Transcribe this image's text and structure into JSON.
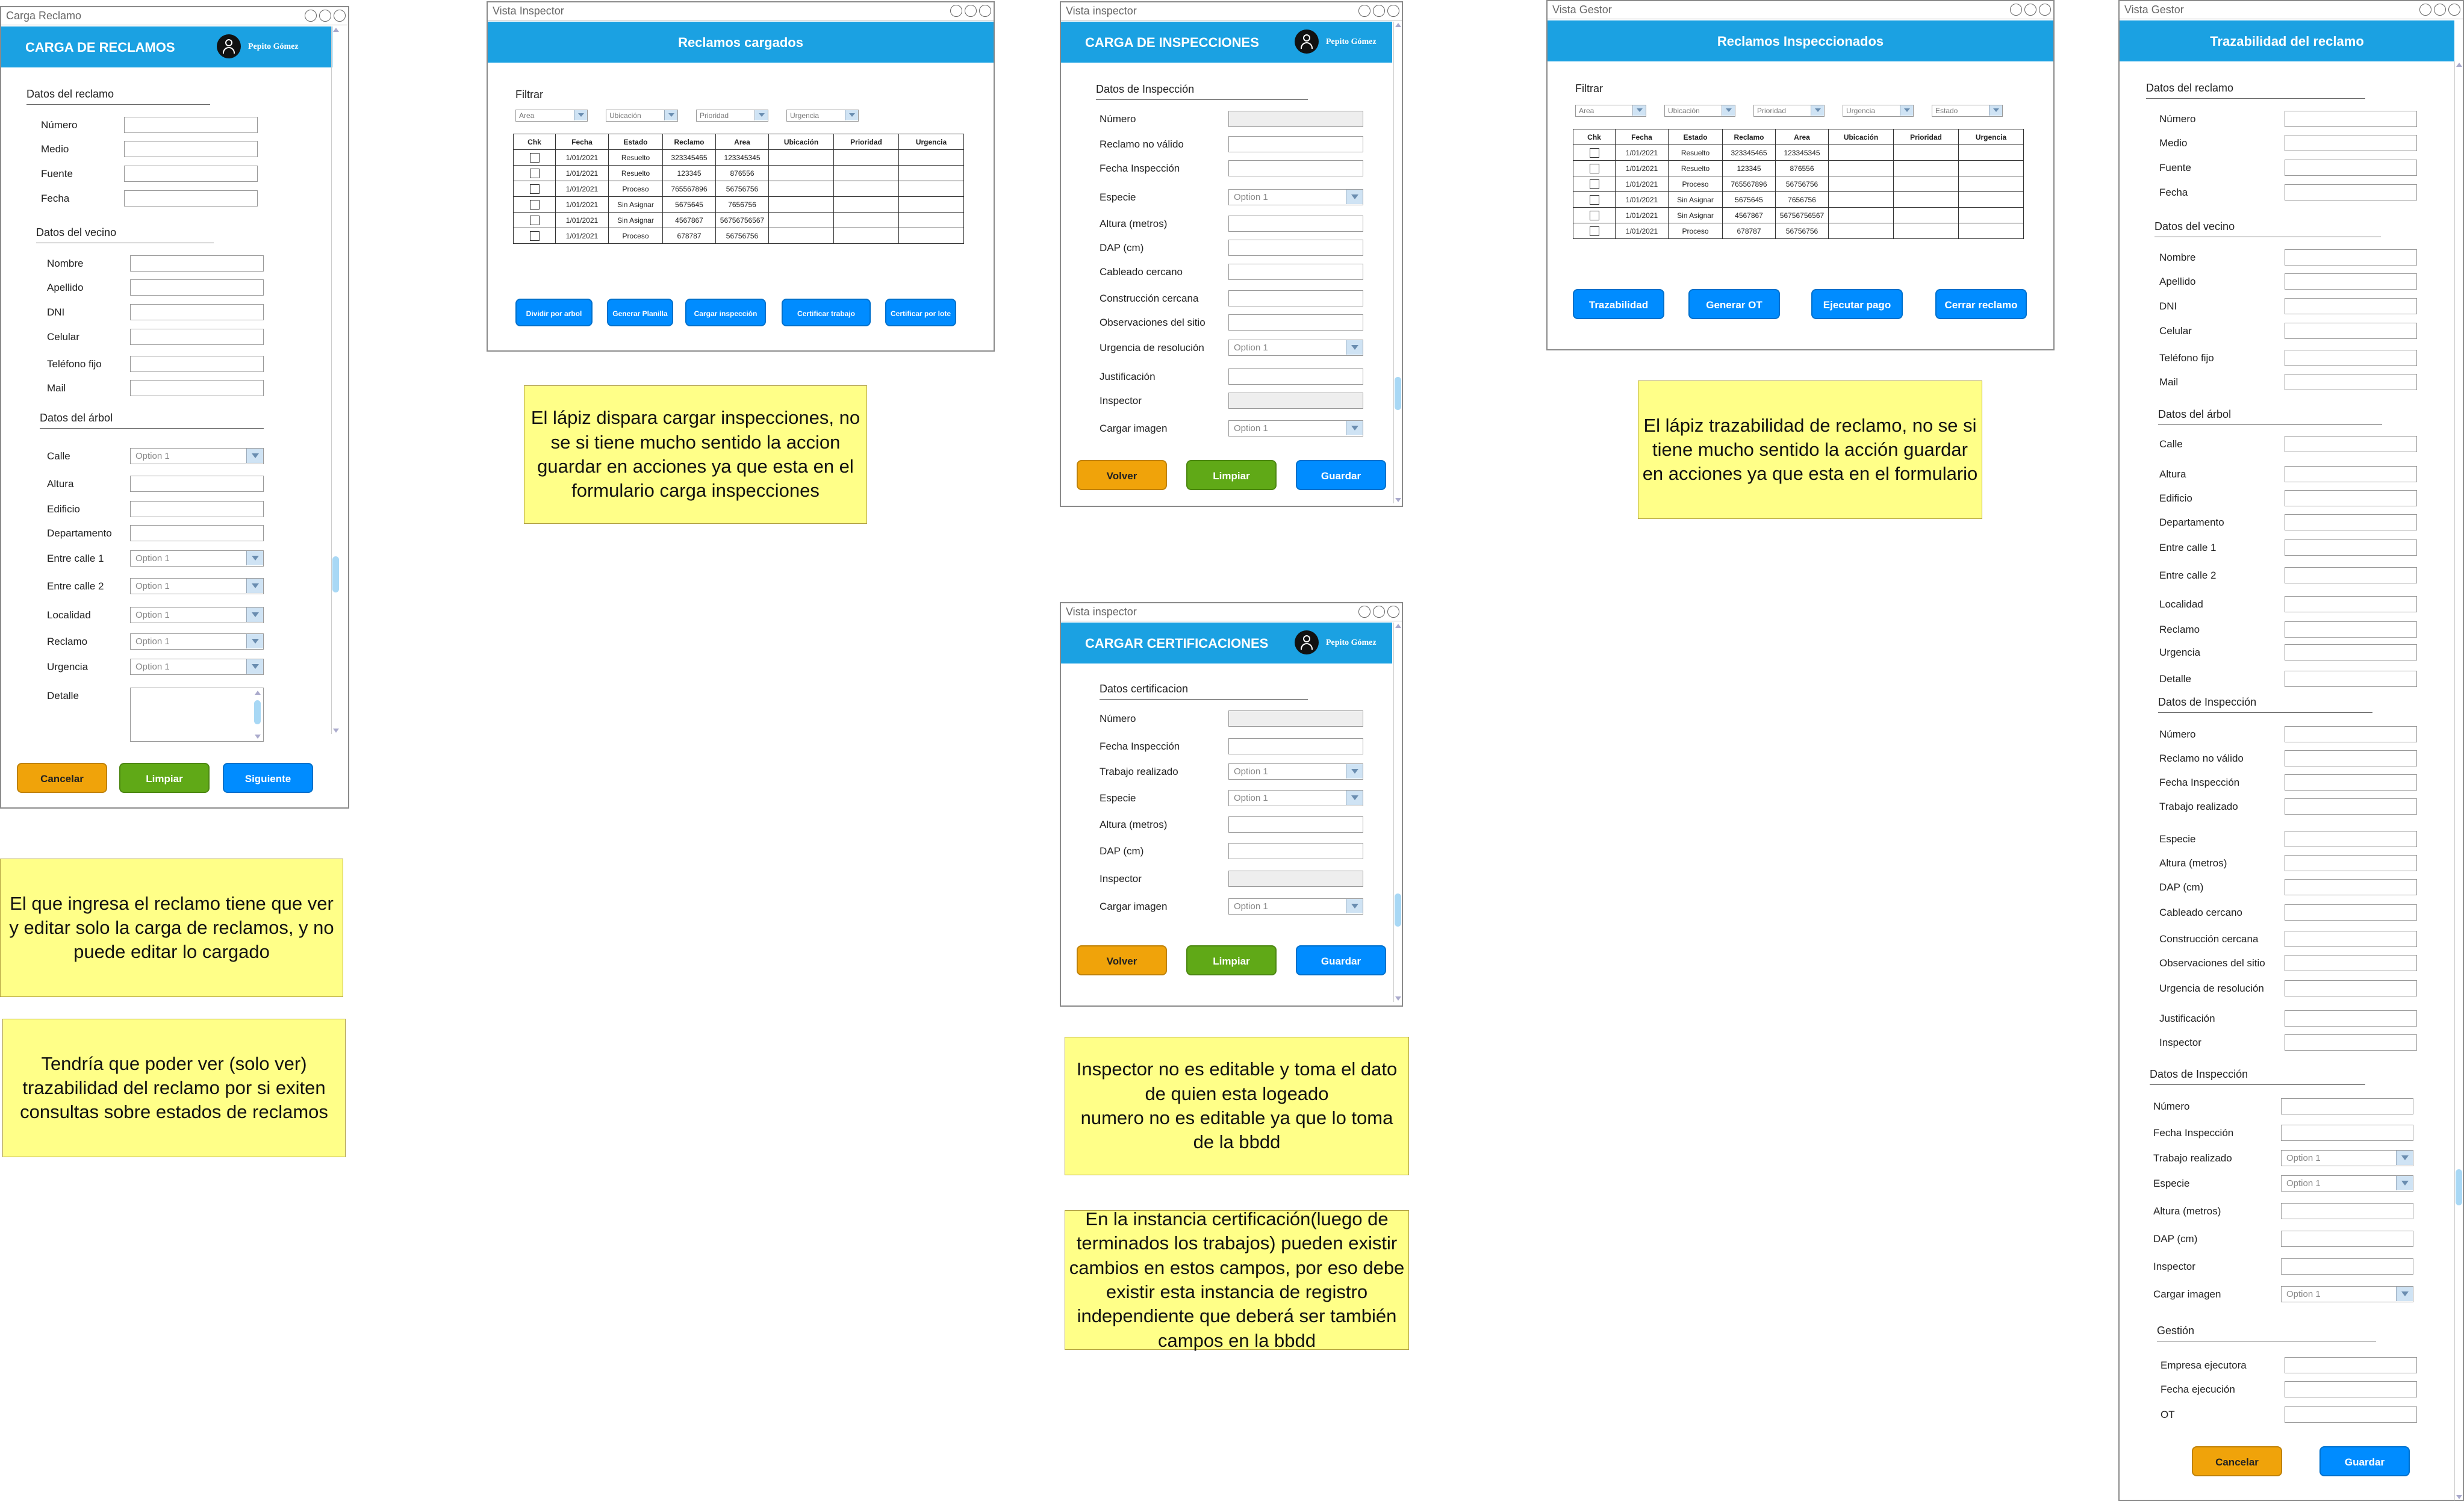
{
  "user_name": "Pepito Gómez",
  "option_placeholder": "Option 1",
  "w1": {
    "window_title": "Carga Reclamo",
    "header": "CARGA DE RECLAMOS",
    "sec_reclamo": "Datos del reclamo",
    "reclamo_fields": [
      "Número",
      "Medio",
      "Fuente",
      "Fecha"
    ],
    "sec_vecino": "Datos del vecino",
    "vecino_fields": [
      "Nombre",
      "Apellido",
      "DNI",
      "Celular",
      "Teléfono fijo",
      "Mail"
    ],
    "sec_arbol": "Datos del árbol",
    "arbol_fields": [
      "Calle",
      "Altura",
      "Edificio",
      "Departamento",
      "Entre calle 1",
      "Entre calle 2",
      "Localidad",
      "Reclamo",
      "Urgencia",
      "Detalle"
    ],
    "buttons": [
      "Cancelar",
      "Limpiar",
      "Siguiente"
    ]
  },
  "w2": {
    "window_title": "Vista Inspector",
    "header": "Reclamos cargados",
    "filter_label": "Filtrar",
    "filters": [
      "Area",
      "Ubicación",
      "Prioridad",
      "Urgencia"
    ],
    "columns": [
      "Chk",
      "Fecha",
      "Estado",
      "Reclamo",
      "Area",
      "Ubicación",
      "Prioridad",
      "Urgencia"
    ],
    "rows": [
      [
        "1/01/2021",
        "Resuelto",
        "323345465",
        "123345345"
      ],
      [
        "1/01/2021",
        "Resuelto",
        "123345",
        "876556"
      ],
      [
        "1/01/2021",
        "Proceso",
        "765567896",
        "56756756"
      ],
      [
        "1/01/2021",
        "Sin Asignar",
        "5675645",
        "7656756"
      ],
      [
        "1/01/2021",
        "Sin Asignar",
        "4567867",
        "56756756567"
      ],
      [
        "1/01/2021",
        "Proceso",
        "678787",
        "56756756"
      ]
    ],
    "buttons": [
      "Dividir por arbol",
      "Generar Planilla",
      "Cargar inspección",
      "Certificar trabajo",
      "Certificar por lote"
    ]
  },
  "w3": {
    "window_title": "Vista inspector",
    "header": "CARGA DE INSPECCIONES",
    "section": "Datos de Inspección",
    "fields": [
      "Número",
      "Reclamo no válido",
      "Fecha Inspección",
      "Especie",
      "Altura (metros)",
      "DAP (cm)",
      "Cableado cercano",
      "Construcción cercana",
      "Observaciones del sitio",
      "Urgencia de resolución",
      "Justificación",
      "Inspector",
      "Cargar imagen"
    ],
    "buttons": [
      "Volver",
      "Limpiar",
      "Guardar"
    ]
  },
  "w4": {
    "window_title": "Vista inspector",
    "header": "CARGAR CERTIFICACIONES",
    "section": "Datos certificacion",
    "fields": [
      "Número",
      "Fecha Inspección",
      "Trabajo realizado",
      "Especie",
      "Altura (metros)",
      "DAP (cm)",
      "Inspector",
      "Cargar imagen"
    ],
    "buttons": [
      "Volver",
      "Limpiar",
      "Guardar"
    ]
  },
  "w5": {
    "window_title": "Vista Gestor",
    "header": "Reclamos Inspeccionados",
    "filter_label": "Filtrar",
    "filters": [
      "Area",
      "Ubicación",
      "Prioridad",
      "Urgencia",
      "Estado"
    ],
    "columns": [
      "Chk",
      "Fecha",
      "Estado",
      "Reclamo",
      "Area",
      "Ubicación",
      "Prioridad",
      "Urgencia"
    ],
    "rows": [
      [
        "1/01/2021",
        "Resuelto",
        "323345465",
        "123345345"
      ],
      [
        "1/01/2021",
        "Resuelto",
        "123345",
        "876556"
      ],
      [
        "1/01/2021",
        "Proceso",
        "765567896",
        "56756756"
      ],
      [
        "1/01/2021",
        "Sin Asignar",
        "5675645",
        "7656756"
      ],
      [
        "1/01/2021",
        "Sin Asignar",
        "4567867",
        "56756756567"
      ],
      [
        "1/01/2021",
        "Proceso",
        "678787",
        "56756756"
      ]
    ],
    "buttons": [
      "Trazabilidad",
      "Generar OT",
      "Ejecutar pago",
      "Cerrar reclamo"
    ]
  },
  "w6": {
    "window_title": "Vista Gestor",
    "header": "Trazabilidad del reclamo",
    "sec_reclamo": "Datos del reclamo",
    "reclamo_fields": [
      "Número",
      "Medio",
      "Fuente",
      "Fecha"
    ],
    "sec_vecino": "Datos del vecino",
    "vecino_fields": [
      "Nombre",
      "Apellido",
      "DNI",
      "Celular",
      "Teléfono fijo",
      "Mail"
    ],
    "sec_arbol": "Datos del árbol",
    "arbol_fields": [
      "Calle",
      "Altura",
      "Edificio",
      "Departamento",
      "Entre calle 1",
      "Entre calle 2",
      "Localidad",
      "Reclamo",
      "Urgencia",
      "Detalle"
    ],
    "sec_insp": "Datos de Inspección",
    "insp_fields": [
      "Número",
      "Reclamo no válido",
      "Fecha Inspección",
      "Trabajo realizado",
      "Especie",
      "Altura (metros)",
      "DAP (cm)",
      "Cableado cercano",
      "Construcción cercana",
      "Observaciones del sitio",
      "Urgencia de resolución",
      "Justificación",
      "Inspector"
    ],
    "sec_insp2": "Datos de Inspección",
    "insp2_fields": [
      "Número",
      "Fecha Inspección",
      "Trabajo realizado",
      "Especie",
      "Altura (metros)",
      "DAP (cm)",
      "Inspector",
      "Cargar imagen"
    ],
    "sec_gestion": "Gestión",
    "gestion_fields": [
      "Empresa ejecutora",
      "Fecha ejecución",
      "OT"
    ],
    "buttons": [
      "Cancelar",
      "Guardar"
    ]
  },
  "notes": [
    "El que ingresa el reclamo tiene que ver y editar solo la carga de reclamos, y no puede editar lo cargado",
    "Tendría que poder ver (solo ver) trazabilidad del reclamo por si exiten consultas sobre estados de reclamos",
    "El lápiz dispara cargar inspecciones, no se si tiene mucho sentido la accion guardar en acciones ya que esta en el formulario carga inspecciones",
    "Inspector no es editable y toma el dato de quien esta logeado\nnumero no es editable ya que lo toma de la bbdd",
    "En la instancia certificación(luego de terminados los trabajos) pueden existir cambios en estos campos, por eso debe existir esta instancia de registro independiente que deberá ser también campos en la bbdd",
    "El lápiz trazabilidad de reclamo, no se si tiene mucho sentido la acción guardar en acciones ya que esta en el formulario"
  ]
}
